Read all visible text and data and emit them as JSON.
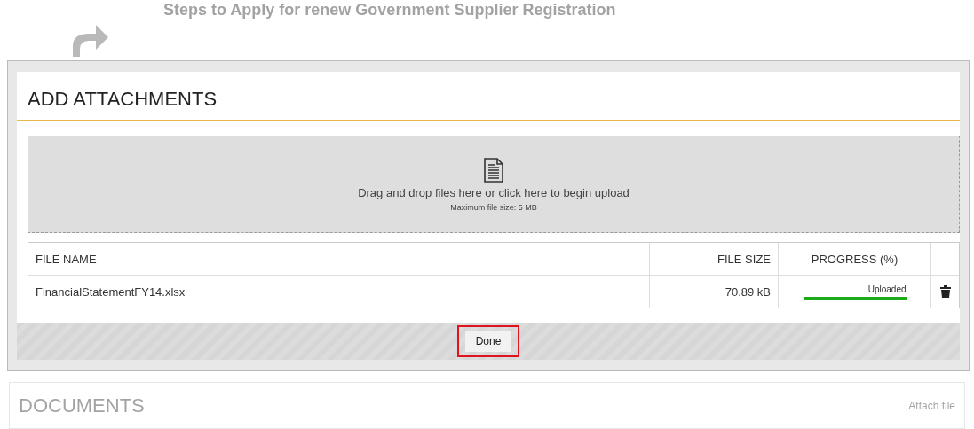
{
  "background_page": {
    "title": "Steps to Apply for renew Government Supplier Registration",
    "section_title": "DOCUMENTS",
    "section_link": "Attach file"
  },
  "dialog": {
    "title": "ADD ATTACHMENTS",
    "dropzone": {
      "instruction": "Drag and drop files here or click here to begin upload",
      "limit": "Maximum file size: 5 MB"
    },
    "table": {
      "columns": [
        "FILE NAME",
        "FILE SIZE",
        "PROGRESS (%)"
      ],
      "rows": [
        {
          "file_name": "FinancialStatementFY14.xlsx",
          "file_size": "70.89 kB",
          "status": "Uploaded",
          "level": 1
        }
      ]
    },
    "buttons": [
      {
        "label": "Done",
        "highlighted": true
      }
    ]
  }
}
